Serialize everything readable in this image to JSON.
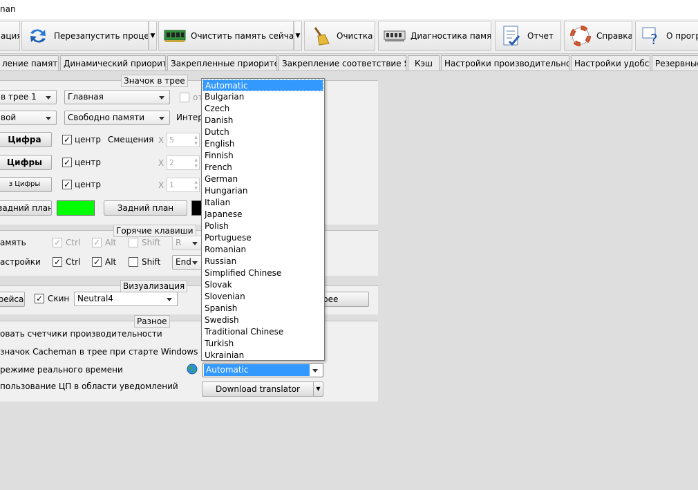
{
  "window": {
    "title_fragment": "nan"
  },
  "toolbar": {
    "items": [
      {
        "label": "ация",
        "icon": "app-icon"
      },
      {
        "label": "Перезапустить процесс",
        "icon": "restart-arrows-icon"
      },
      {
        "label": "Очистить память сейчас!",
        "icon": "memory-chip-icon"
      },
      {
        "label": "Очистка",
        "icon": "broom-icon"
      },
      {
        "label": "Диагностика памяти",
        "icon": "memory-diagnostic-icon"
      },
      {
        "label": "Отчет",
        "icon": "report-checklist-icon"
      },
      {
        "label": "Справка",
        "icon": "lifebuoy-icon"
      },
      {
        "label": "О програ",
        "icon": "about-question-icon"
      }
    ]
  },
  "tabs": [
    "ление памятью",
    "Динамический приоритет",
    "Закрепленные приоритеты",
    "Закрепление соответствие Ядра",
    "Кэш",
    "Настройки производительности",
    "Настройки удобств",
    "Резервные"
  ],
  "tray_group": {
    "legend": "Значок в трее",
    "combo1": "в трее 1",
    "combo2": "Главная",
    "combo3": "вой",
    "combo4": "Свободно памяти",
    "interval_label": "Интер",
    "disabled_text": "от",
    "rows": [
      {
        "button": "Цифра",
        "center": "центр",
        "x": "X",
        "value": "5"
      },
      {
        "button": "Цифры",
        "center": "центр",
        "x": "X",
        "value": "2"
      },
      {
        "button": "з Цифры",
        "center": "центр",
        "x": "X",
        "value": "1"
      }
    ],
    "offsets_label": "Смещения",
    "bg_button1": "задний план",
    "bg_button2": "Задний план",
    "swatch1": "#00ff00",
    "swatch2": "#000000"
  },
  "hotkeys_group": {
    "legend": "Горячие клавиши",
    "rows": [
      {
        "label": "амять",
        "ctrl": "Ctrl",
        "alt": "Alt",
        "shift": "Shift",
        "key": "R",
        "enabled": false
      },
      {
        "label": "астройки",
        "ctrl": "Ctrl",
        "alt": "Alt",
        "shift": "Shift",
        "key": "End",
        "enabled": true
      }
    ]
  },
  "visual_group": {
    "legend": "Визуализация",
    "button": "рейса",
    "skin_label": "Скин",
    "skin_value": "Neutral4",
    "right_button": "рее"
  },
  "misc_group": {
    "legend": "Разное",
    "lines": [
      "овать счетчики производительности",
      "значок Cacheman в трее при старте Windows",
      "режиме реального времени",
      "пользование ЦП в области уведомлений"
    ],
    "language_combo": "Automatic",
    "download_button": "Download translator"
  },
  "language_dropdown": {
    "options": [
      "Automatic",
      "Bulgarian",
      "Czech",
      "Danish",
      "Dutch",
      "English",
      "Finnish",
      "French",
      "German",
      "Hungarian",
      "Italian",
      "Japanese",
      "Polish",
      "Portuguese",
      "Romanian",
      "Russian",
      "Simplified Chinese",
      "Slovak",
      "Slovenian",
      "Spanish",
      "Swedish",
      "Traditional Chinese",
      "Turkish",
      "Ukrainian"
    ],
    "selected": "Automatic"
  }
}
